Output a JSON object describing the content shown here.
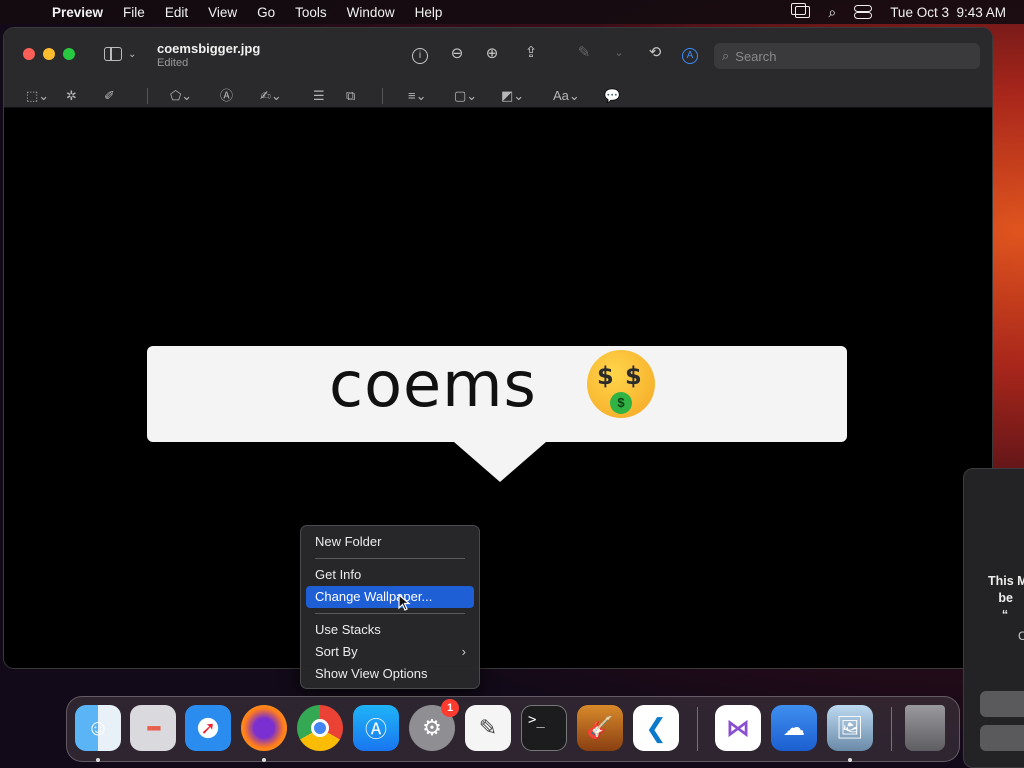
{
  "menubar": {
    "app_name": "Preview",
    "menus": [
      "File",
      "Edit",
      "View",
      "Go",
      "Tools",
      "Window",
      "Help"
    ],
    "clock": "Tue Oct 3  9:43 AM"
  },
  "window": {
    "title": "coemsbigger.jpg",
    "subtitle": "Edited",
    "search_placeholder": "Search",
    "text_style_label": "Aa"
  },
  "image": {
    "bubble_text": "coems",
    "emoji_eyes": "$",
    "emoji_tongue": "$"
  },
  "context_menu": {
    "items": [
      {
        "label": "New Folder"
      },
      {
        "label": "Get Info"
      },
      {
        "label": "Change Wallpaper..."
      },
      {
        "label": "Use Stacks"
      },
      {
        "label": "Sort By"
      },
      {
        "label": "Show View Options"
      }
    ],
    "highlighted": "Change Wallpaper...",
    "sort_by_arrow": "›"
  },
  "dialog": {
    "text_lines": "This M\n   be\n    “",
    "sub": "C"
  },
  "dock": {
    "apps": [
      "Finder",
      "Launchpad",
      "Safari",
      "Firefox",
      "Chrome",
      "App Store",
      "System Settings",
      "TextEdit",
      "Terminal",
      "GarageBand",
      "Visual Studio Code",
      "Visual Studio",
      "Weather",
      "Preview",
      "Trash"
    ],
    "settings_badge": "1",
    "terminal_glyph": ">_"
  },
  "colors": {
    "highlight": "#1f5fd6",
    "close": "#ff5f57",
    "minimize": "#febc2e",
    "maximize": "#28c840"
  }
}
